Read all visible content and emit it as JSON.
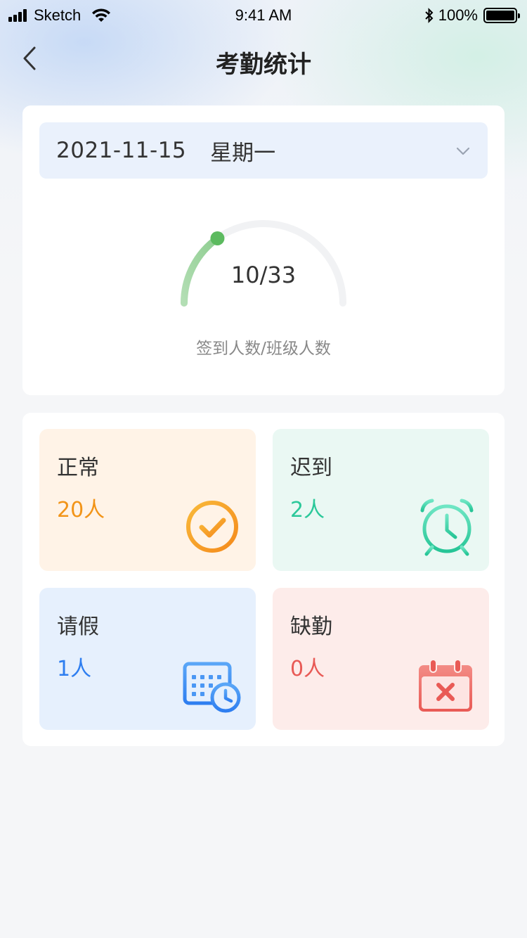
{
  "status_bar": {
    "carrier": "Sketch",
    "time": "9:41 AM",
    "battery": "100%"
  },
  "nav": {
    "title": "考勤统计"
  },
  "date_picker": {
    "date": "2021-11-15",
    "weekday": "星期一"
  },
  "gauge": {
    "checked_in": 10,
    "class_total": 33,
    "value_text": "10/33",
    "caption": "签到人数/班级人数"
  },
  "stats": {
    "normal": {
      "label": "正常",
      "count": "20人",
      "color": "#f29418",
      "icon": "check-circle-icon"
    },
    "late": {
      "label": "迟到",
      "count": "2人",
      "color": "#2cc89a",
      "icon": "alarm-clock-icon"
    },
    "leave": {
      "label": "请假",
      "count": "1人",
      "color": "#2e7ef0",
      "icon": "calendar-clock-icon"
    },
    "absent": {
      "label": "缺勤",
      "count": "0人",
      "color": "#e85a56",
      "icon": "calendar-x-icon"
    }
  }
}
